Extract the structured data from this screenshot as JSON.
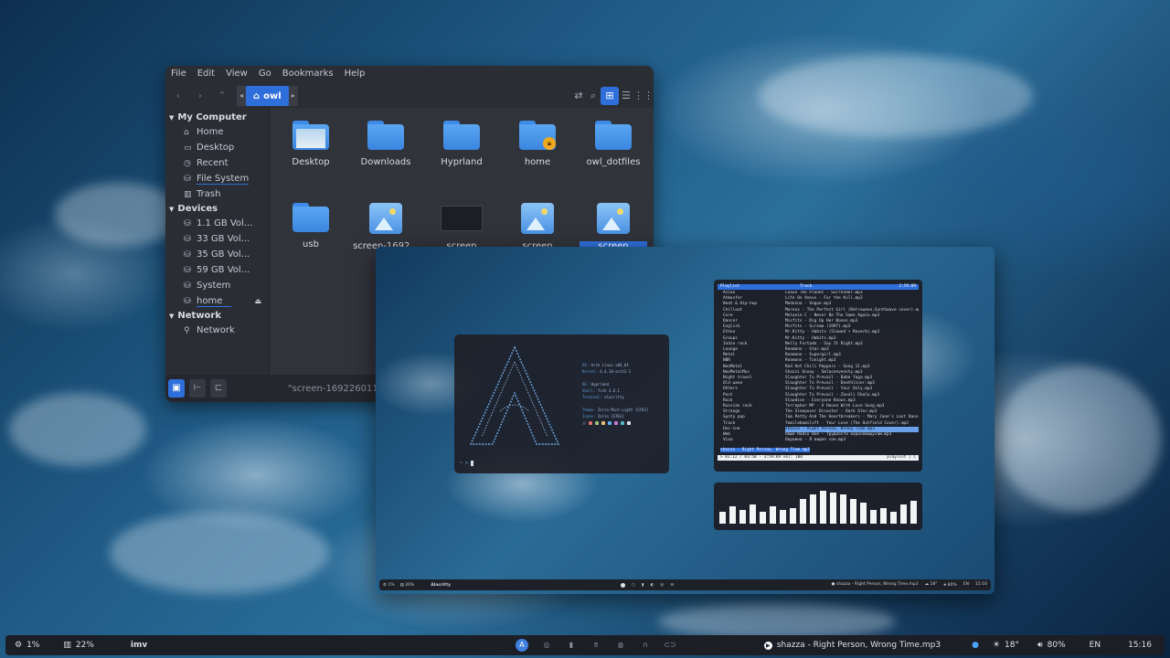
{
  "file_manager": {
    "menu": [
      "File",
      "Edit",
      "View",
      "Go",
      "Bookmarks",
      "Help"
    ],
    "breadcrumb": "owl",
    "sidebar": {
      "my_computer": {
        "heading": "My Computer",
        "items": [
          "Home",
          "Desktop",
          "Recent",
          "File System",
          "Trash"
        ]
      },
      "devices": {
        "heading": "Devices",
        "items": [
          "1.1 GB Vol...",
          "33 GB Vol...",
          "35 GB Vol...",
          "59 GB Vol...",
          "System",
          "home"
        ]
      },
      "network": {
        "heading": "Network",
        "items": [
          "Network"
        ]
      }
    },
    "files_row1": [
      "Desktop",
      "Downloads",
      "Hyprland",
      "home",
      "owl_dotfiles"
    ],
    "files_row2": [
      "usb",
      "screen-1692...",
      "screen",
      "screen",
      "screen"
    ],
    "status_text": "\"screen-1692260111.p"
  },
  "neofetch": {
    "os_label": "OS:",
    "os": "Arch Linux x86_64",
    "kernel_label": "Kernel:",
    "kernel": "6.4.10-arch1-1",
    "de_label": "DE:",
    "de": "Hyprland",
    "shell_label": "Shell:",
    "shell": "fish 3.6.1",
    "terminal_label": "Terminal:",
    "terminal": "alacritty",
    "theme_label": "Theme:",
    "theme": "Zorin-Mint-Light [GTK3]",
    "icons_label": "Icons:",
    "icons": "Zorin [GTK3]",
    "swatch_colors": [
      "#3a3f4b",
      "#e06c75",
      "#98c379",
      "#e5c07b",
      "#61afef",
      "#c678dd",
      "#56b6c2",
      "#dcdfe4"
    ],
    "prompt": "~ > "
  },
  "music": {
    "col_playlist": "Playlist",
    "col_track": "Track",
    "col_time": "2:59:09",
    "playlists": [
      "Asian",
      "Atmosfer",
      "Beat & Hip-hop",
      "Chillout",
      "Core",
      "Dancer",
      "English",
      "Ethno",
      "Groups",
      "Indie rock",
      "Lounge",
      "Metal",
      "NBR",
      "NeoMetal",
      "NeoMetalMus",
      "Night travel",
      "Old wave",
      "Others",
      "Post",
      "Rock",
      "Russian rock",
      "Strange",
      "Synty pop",
      "Track",
      "Unc-ine",
      "Web",
      "Vixa"
    ],
    "tracks": [
      "Leave The Planet - Surrender.mp3",
      "Life On Venus - For the Kill.mp3",
      "Madonna - Vogue.mp3",
      "Marexx - The Perfect Girl (Retrowave,Synthwave cover).mp3",
      "Melanie C - Never Be The Same Again.mp3",
      "Misfits - Dig Up Her Bones.mp3",
      "Misfits - Scream (1997).mp3",
      "Mr.Kitty - Habits (Slowed + Reverb).mp3",
      "Mr.Kitty - Habits.mp3",
      "Nelly Furtado - Say It Right.mp3",
      "Reamonn - Star.mp3",
      "Reamonn - Supergirl.mp3",
      "Reamonn - Tonight.mp3",
      "Red Hot Chili Peppers - Song 11.mp3",
      "Shazzi Oceay - Smlacenvensty.mp3",
      "Slaughter To Prevail - Baba Yaga.mp3",
      "Slaughter To Prevail - Deathliner.mp3",
      "Slaughter To Prevail - Your Only.mp3",
      "Slaughter To Prevail - Zavali Ebalo.mp3",
      "Slowdive - Everyone Knows.mp3",
      "Terraphor MP - A House With Love Song.mp3",
      "The Sleepover Disaster - Dark Star.mp3",
      "Tom Petty And The Heartbreakers - Mary Jane's Last Dance.mp3",
      "fomilebomilsft - Your Love (The Outfield Cover).mp3",
      "shazza - Right Person, Wrong Time.mp3",
      "Наше Radio Boe - Трудности коронавирусам.mp3",
      "Окраина - Я видел сон.mp3"
    ],
    "selected_track_index": 24,
    "now_playing": "shazza - Right Person, Wrong Time.mp3",
    "status_left": "> 01:12 / 03:58 - 3:59:09 vol: 100",
    "status_right": "playlist | C",
    "visualizer_levels": [
      0.35,
      0.5,
      0.4,
      0.55,
      0.35,
      0.5,
      0.4,
      0.45,
      0.7,
      0.85,
      0.95,
      0.9,
      0.85,
      0.7,
      0.6,
      0.4,
      0.45,
      0.35,
      0.55,
      0.65
    ]
  },
  "inner_bar": {
    "cpu": "1%",
    "mem": "26%",
    "app": "Alacritty",
    "media": "shazza - Right Person, Wrong Time.mp3",
    "temp": "18°",
    "vol": "80%",
    "lang": "EN",
    "time": "15:16"
  },
  "taskbar": {
    "cpu": "1%",
    "mem": "22%",
    "app": "imv",
    "workspace_active": "A",
    "media": "shazza - Right Person, Wrong Time.mp3",
    "weather": "18°",
    "volume": "80%",
    "lang": "EN",
    "clock": "15:16"
  }
}
